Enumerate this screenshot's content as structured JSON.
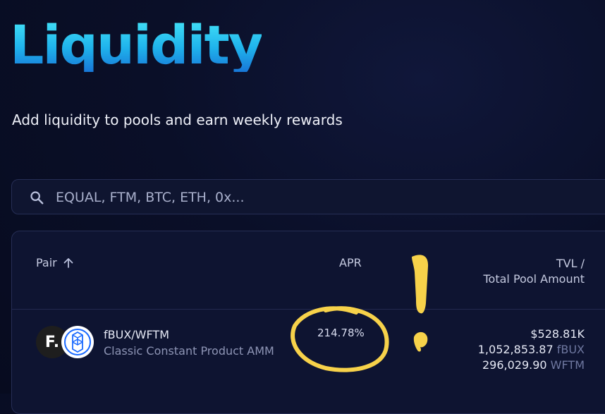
{
  "page": {
    "title": "Liquidity",
    "subtitle": "Add liquidity to pools and earn weekly rewards"
  },
  "search": {
    "placeholder": "EQUAL, FTM, BTC, ETH, 0x...",
    "icon": "search-icon"
  },
  "table": {
    "columns": {
      "pair": "Pair",
      "apr": "APR",
      "tvl_line1": "TVL /",
      "tvl_line2": "Total Pool Amount"
    },
    "sort": {
      "column": "pair",
      "direction": "ascending",
      "icon": "arrow-up-icon"
    },
    "rows": [
      {
        "pair": "fBUX/WFTM",
        "type": "Classic Constant Product AMM",
        "apr": "214.78%",
        "tvl": "$528.81K",
        "amount_a": "1,052,853.87",
        "token_a": "fBUX",
        "amount_b": "296,029.90",
        "token_b": "WFTM",
        "token_a_logo_text": "F."
      }
    ]
  },
  "colors": {
    "title_gradient_top": "#44e3f7",
    "title_gradient_bottom": "#1877d8",
    "background": "#0a0f28",
    "annotation": "#f7d24a"
  }
}
